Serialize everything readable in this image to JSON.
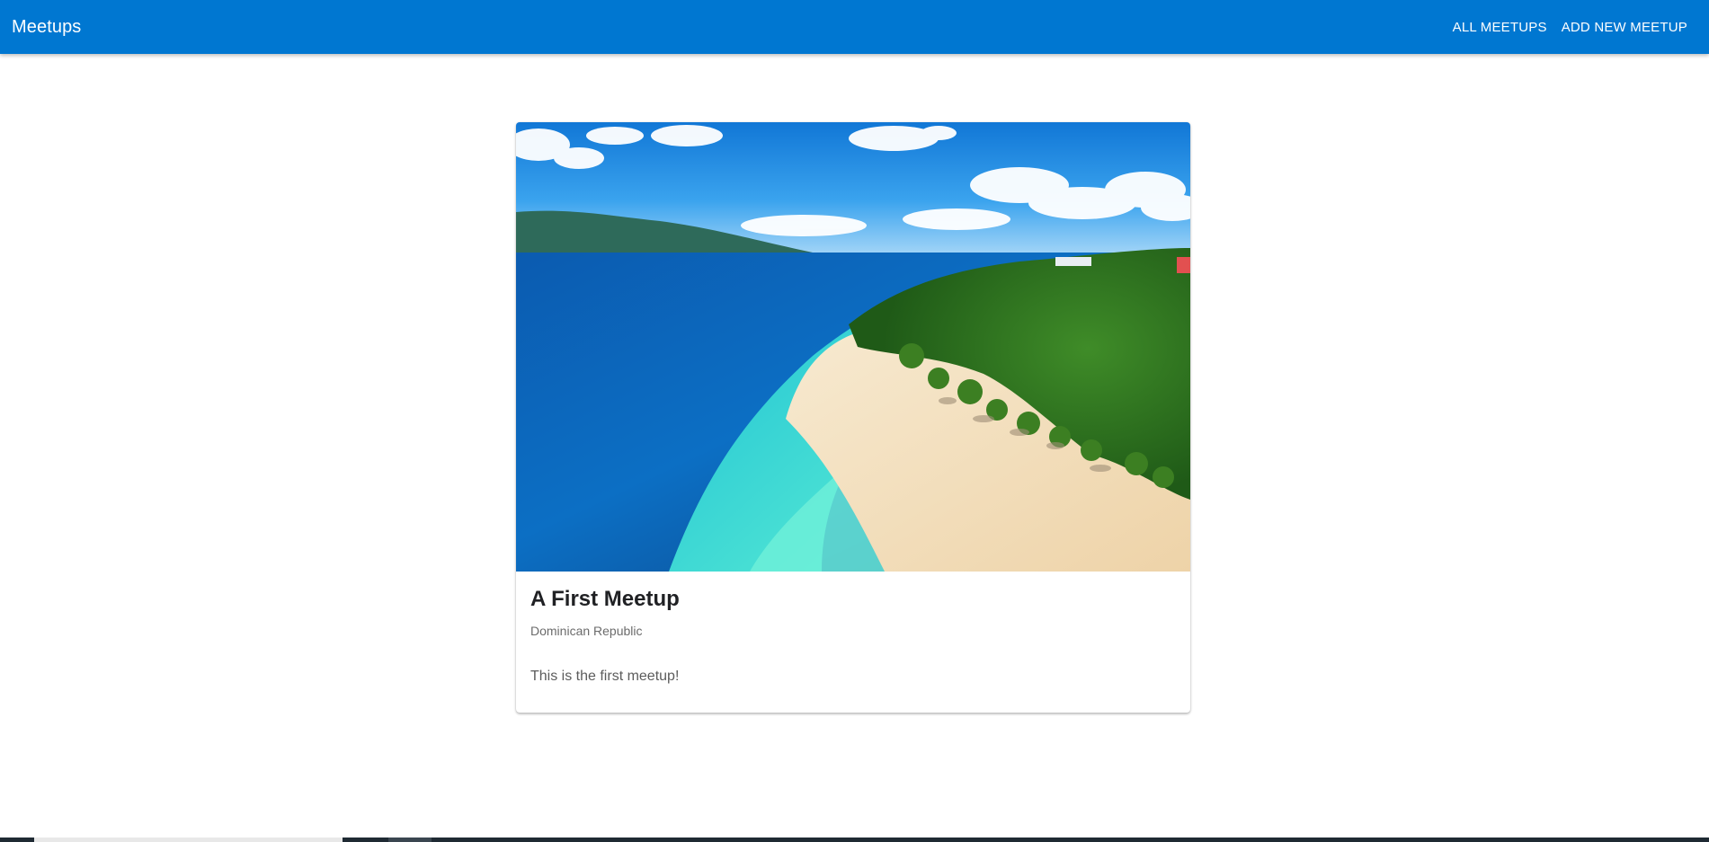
{
  "header": {
    "brand": "Meetups",
    "nav": [
      {
        "label": "ALL MEETUPS"
      },
      {
        "label": "ADD NEW MEETUP"
      }
    ]
  },
  "meetup": {
    "title": "A First Meetup",
    "address": "Dominican Republic",
    "description": "This is the first meetup!"
  },
  "colors": {
    "header_bg": "#0077d1",
    "sky": "#1e90e8",
    "sea_deep": "#0f4f9a",
    "sea_shallow": "#2fd6c8",
    "sand": "#f3e2c2",
    "jungle": "#2f6e1f"
  }
}
